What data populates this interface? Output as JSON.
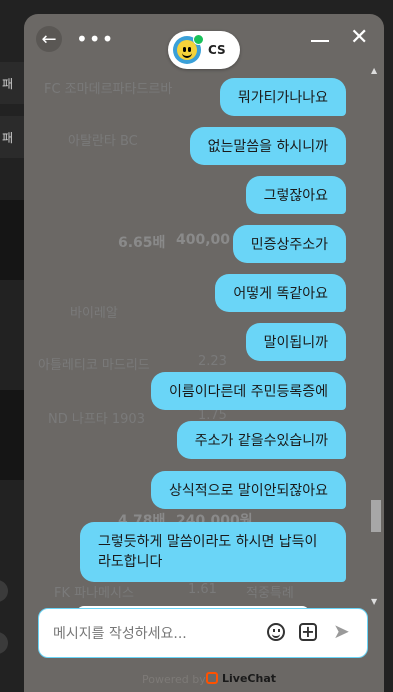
{
  "background_page": {
    "left_cells": [
      "패",
      "패"
    ],
    "ghost_texts": {
      "row1": "FC 조마데르파타드르바",
      "row2": "아탈란타 BC",
      "odds_a": "6.65배",
      "odds_b": "400,00",
      "row3": "바이레알",
      "row4": "아틀레티코 마드리드",
      "row4_odds": "2.23",
      "row5": "ND 나프타 1903",
      "row5_odds": "1.75",
      "odds_c": "4.78배",
      "odds_d": "240,000원",
      "row6": "FK 파나메시스",
      "row6_odds": "1.61",
      "row6_status": "적중특례"
    }
  },
  "chat": {
    "header": {
      "back_icon": "←",
      "more_icon": "•••",
      "agent_name": "CS",
      "close_icon": "✕"
    },
    "messages": [
      "뭐가티가나나요",
      "없는말씀을 하시니까",
      "그렇잖아요",
      "민증상주소가",
      "어떻게 똑같아요",
      "말이됩니까",
      "이름이다른데 주민등록증에",
      "주소가 같을수있습니까",
      "상식적으로 말이안되잖아요",
      "그렇듯하게 말씀이라도 하시면 납득이라도합니다"
    ],
    "composer": {
      "placeholder": "메시지를 작성하세요..."
    },
    "footer": {
      "powered_by": "Powered by",
      "brand": "LiveChat",
      "brand_color": "#ff5100"
    },
    "colors": {
      "bubble": "#6ad5f7",
      "panel": "#6b6865"
    }
  }
}
